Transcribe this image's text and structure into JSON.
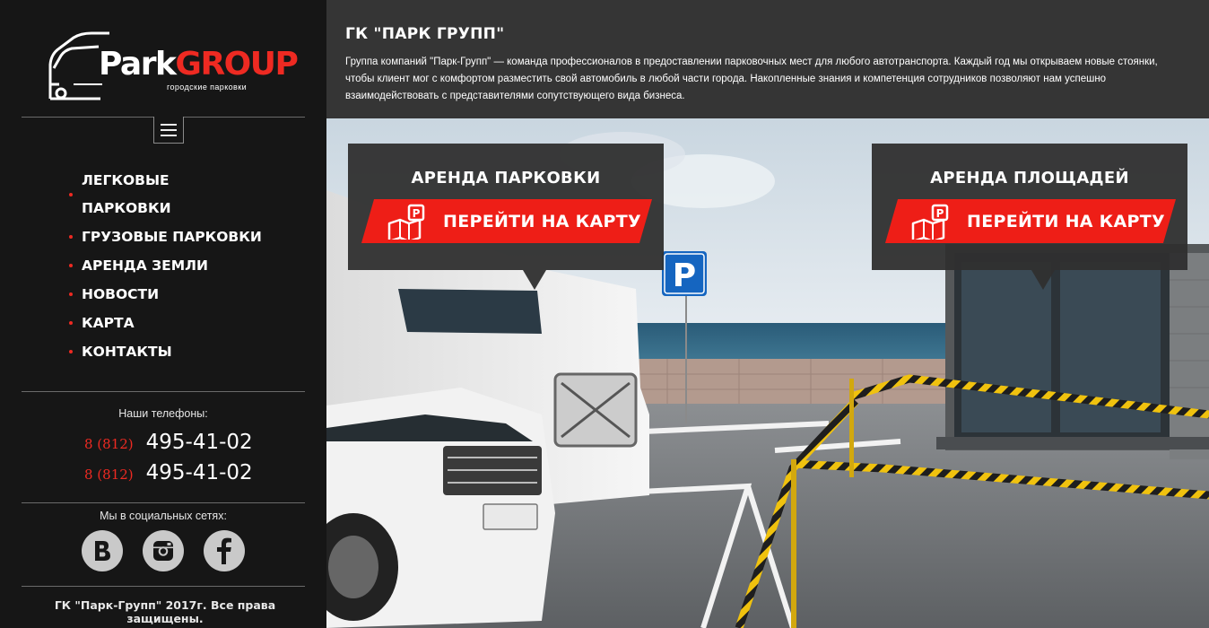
{
  "logo": {
    "text_park": "Park",
    "text_group": "GROUP",
    "subtitle": "городские парковки"
  },
  "nav": {
    "items": [
      {
        "label": "Легковые парковки"
      },
      {
        "label": "Грузовые парковки"
      },
      {
        "label": "Аренда земли"
      },
      {
        "label": "Новости"
      },
      {
        "label": "Карта"
      },
      {
        "label": "Контакты"
      }
    ]
  },
  "contacts": {
    "phones_title": "Наши телефоны:",
    "phones": [
      {
        "code": "8 (812)",
        "number": "495-41-02"
      },
      {
        "code": "8 (812)",
        "number": "495-41-02"
      }
    ],
    "social_title": "Мы в социальных сетях:",
    "social": [
      {
        "icon": "vk-icon"
      },
      {
        "icon": "instagram-icon"
      },
      {
        "icon": "facebook-icon"
      }
    ],
    "copyright": "ГК \"Парк-Групп\" 2017г. Все права защищены."
  },
  "header": {
    "title": "ГК \"ПАРК ГРУПП\"",
    "description": "Группа компаний \"Парк-Групп\" — команда профессионалов в предоставлении парковочных мест для любого автотранспорта. Каждый год мы открываем новые стоянки, чтобы клиент мог с комфортом разместить свой автомобиль в любой части города. Накопленные знания и компетенция сотрудников позволяют нам успешно взаимодействовать с представителями сопутствующего вида бизнеса."
  },
  "cards": [
    {
      "title": "Аренда парковки",
      "button": "Перейти на карту",
      "icon": "parking-map-icon"
    },
    {
      "title": "Аренда площадей",
      "button": "Перейти на карту",
      "icon": "parking-map-icon"
    }
  ],
  "parking_sign": {
    "letter": "P"
  },
  "colors": {
    "accent": "#ee1e17",
    "sidebar_bg": "#161616",
    "header_bg": "#353535",
    "card_bg": "#2f2f2f"
  }
}
